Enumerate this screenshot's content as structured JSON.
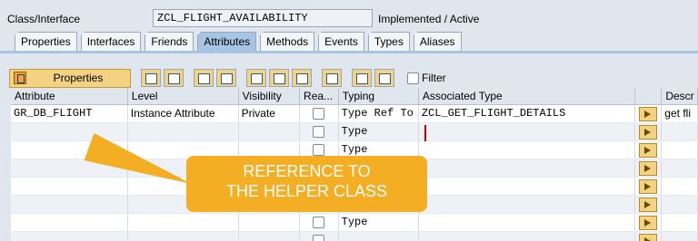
{
  "header": {
    "class_label": "Class/Interface",
    "class_name": "ZCL_FLIGHT_AVAILABILITY",
    "status": "Implemented / Active"
  },
  "tabs": [
    {
      "label": "Properties"
    },
    {
      "label": "Interfaces"
    },
    {
      "label": "Friends"
    },
    {
      "label": "Attributes"
    },
    {
      "label": "Methods"
    },
    {
      "label": "Events"
    },
    {
      "label": "Types"
    },
    {
      "label": "Aliases"
    }
  ],
  "toolbar": {
    "properties_label": "Properties",
    "filter_label": "Filter"
  },
  "grid": {
    "columns": [
      "Attribute",
      "Level",
      "Visibility",
      "Rea...",
      "Typing",
      "Associated Type",
      "",
      "Descr"
    ],
    "rows": [
      {
        "attribute": "GR_DB_FLIGHT",
        "level": "Instance Attribute",
        "visibility": "Private",
        "typing": "Type Ref To",
        "assoc": "ZCL_GET_FLIGHT_DETAILS",
        "descr": "get fli"
      },
      {
        "attribute": "",
        "level": "",
        "visibility": "",
        "typing": "Type",
        "assoc": "",
        "descr": ""
      },
      {
        "attribute": "",
        "level": "",
        "visibility": "",
        "typing": "Type",
        "assoc": "",
        "descr": ""
      },
      {
        "attribute": "",
        "level": "",
        "visibility": "",
        "typing": "",
        "assoc": "",
        "descr": ""
      },
      {
        "attribute": "",
        "level": "",
        "visibility": "",
        "typing": "",
        "assoc": "",
        "descr": ""
      },
      {
        "attribute": "",
        "level": "",
        "visibility": "",
        "typing": "",
        "assoc": "",
        "descr": ""
      },
      {
        "attribute": "",
        "level": "",
        "visibility": "",
        "typing": "Type",
        "assoc": "",
        "descr": ""
      },
      {
        "attribute": "",
        "level": "",
        "visibility": "",
        "typing": "",
        "assoc": "",
        "descr": ""
      }
    ]
  },
  "callout": {
    "line1": "REFERENCE TO",
    "line2": "THE HELPER CLASS"
  }
}
